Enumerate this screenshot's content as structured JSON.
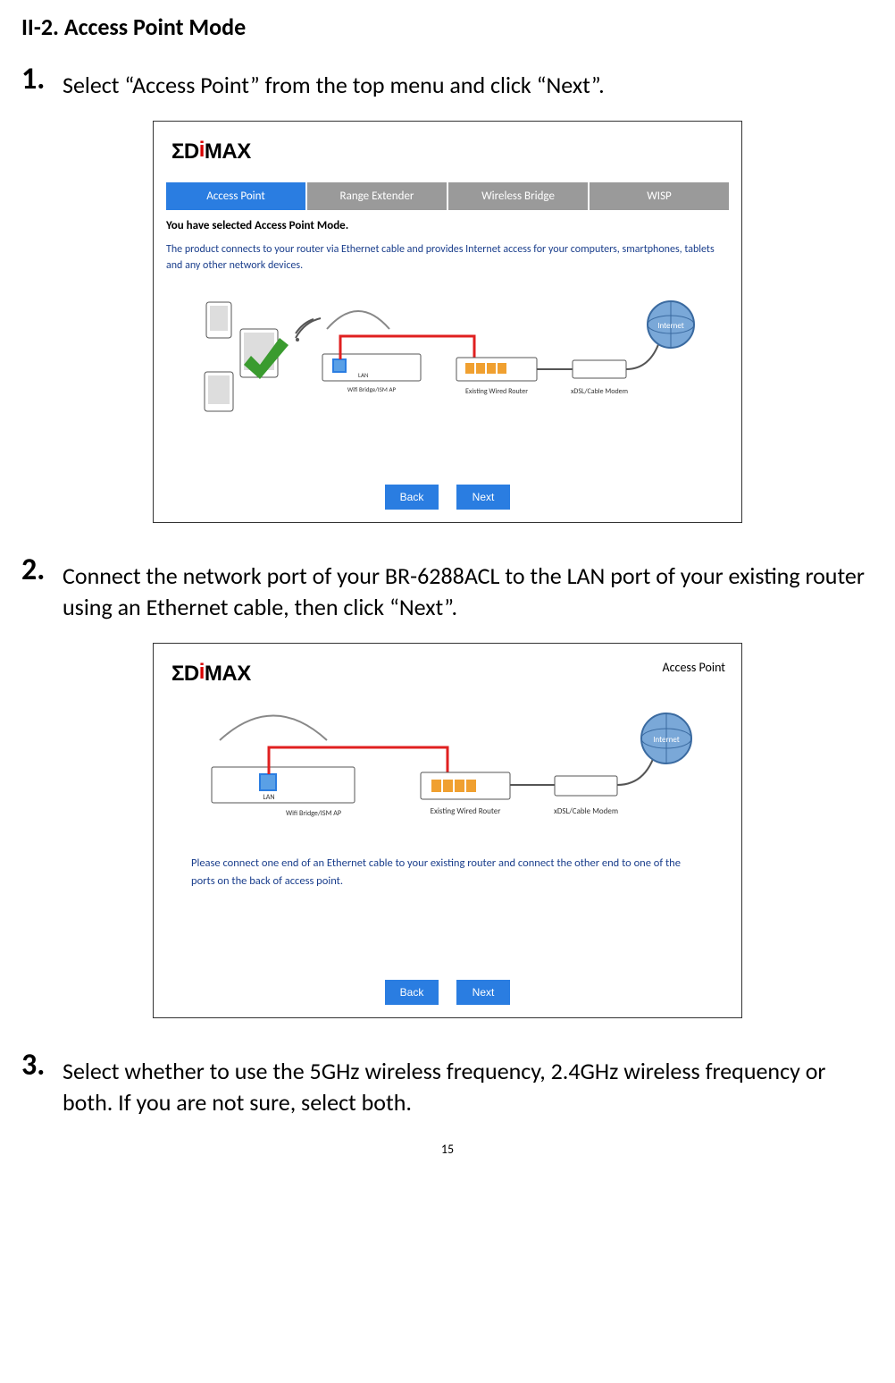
{
  "section_heading": "II-2. Access Point Mode",
  "steps": {
    "s1_num": "1.",
    "s1_text": "Select “Access Point” from the top menu and click “Next”.",
    "s2_num": "2.",
    "s2_text": "Connect the network port of your BR-6288ACL to the LAN port of your existing router using an Ethernet cable, then click “Next”.",
    "s3_num": "3.",
    "s3_text": "Select whether to use the 5GHz wireless frequency, 2.4GHz wireless frequency or both. If you are not sure, select both."
  },
  "screenshot1": {
    "brand_before": "ΣD",
    "brand_mid": "i",
    "brand_after": "MAX",
    "tabs": [
      {
        "label": "Access Point",
        "active": true
      },
      {
        "label": "Range Extender",
        "active": false
      },
      {
        "label": "Wireless Bridge",
        "active": false
      },
      {
        "label": "WISP",
        "active": false
      }
    ],
    "selected_mode_line": "You have selected Access Point Mode.",
    "description": "The product connects to your router via Ethernet cable and provides Internet access for your computers, smartphones, tablets and any other network devices.",
    "diagram": {
      "device_label": "Wifi Bridge/ISM AP",
      "router_label": "Existing Wired Router",
      "modem_label": "xDSL/Cable Modem",
      "internet_label": "Internet",
      "lan_label": "LAN"
    },
    "back_label": "Back",
    "next_label": "Next"
  },
  "screenshot2": {
    "brand_before": "ΣD",
    "brand_mid": "i",
    "brand_after": "MAX",
    "mode_badge": "Access Point",
    "diagram": {
      "device_label": "Wifi Bridge/ISM AP",
      "router_label": "Existing Wired Router",
      "modem_label": "xDSL/Cable Modem",
      "internet_label": "Internet",
      "lan_label": "LAN"
    },
    "instruction": "Please connect one end of an Ethernet cable to your existing router and connect the other end to one of the ports on the back of access point.",
    "back_label": "Back",
    "next_label": "Next"
  },
  "page_number": "15"
}
